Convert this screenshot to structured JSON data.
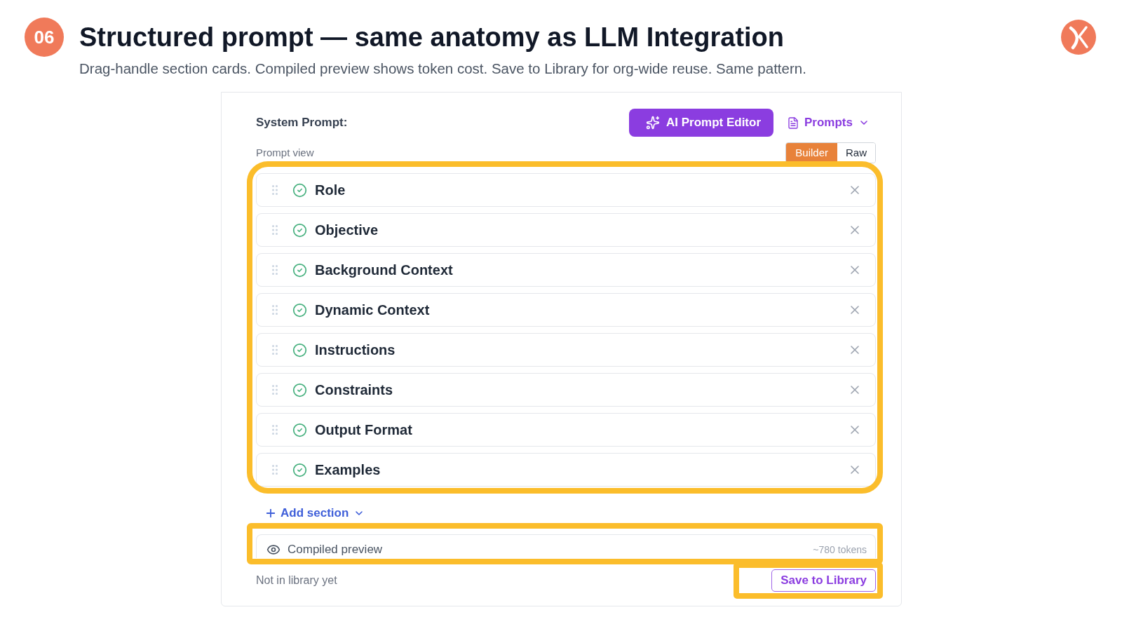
{
  "header": {
    "badge": "06",
    "title": "Structured prompt — same anatomy as LLM Integration",
    "subtitle": "Drag-handle section cards. Compiled preview shows token cost. Save to Library for org-wide reuse. Same pattern."
  },
  "panel": {
    "system_prompt_label": "System Prompt:",
    "ai_button": "AI Prompt Editor",
    "prompts_menu": "Prompts",
    "prompt_view_label": "Prompt view",
    "view_toggle": [
      {
        "label": "Builder",
        "selected": true
      },
      {
        "label": "Raw",
        "selected": false
      }
    ],
    "sections": [
      {
        "label": "Role",
        "complete": true
      },
      {
        "label": "Objective",
        "complete": true
      },
      {
        "label": "Background Context",
        "complete": true
      },
      {
        "label": "Dynamic Context",
        "complete": true
      },
      {
        "label": "Instructions",
        "complete": true
      },
      {
        "label": "Constraints",
        "complete": true
      },
      {
        "label": "Output Format",
        "complete": true
      },
      {
        "label": "Examples",
        "complete": true
      }
    ],
    "add_section": "Add section",
    "compiled_preview": {
      "label": "Compiled preview",
      "tokens": "~780 tokens"
    },
    "library_status": "Not in library yet",
    "save_button": "Save to Library"
  }
}
